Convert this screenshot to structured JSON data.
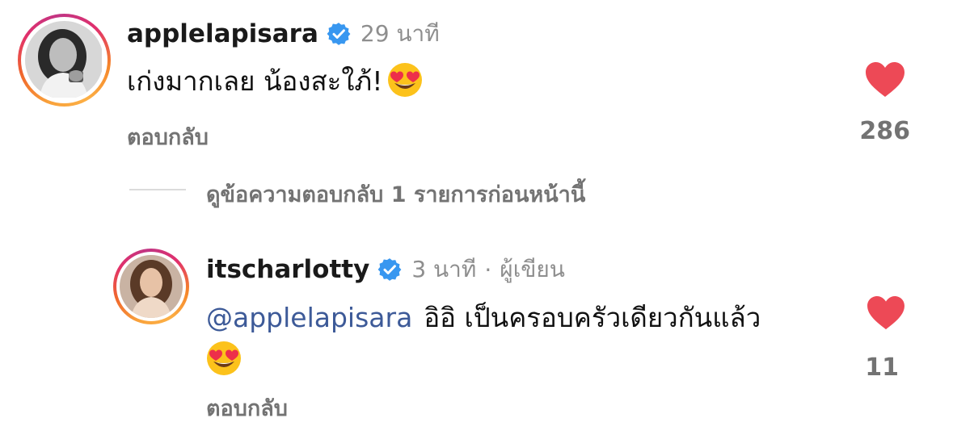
{
  "comments": [
    {
      "username": "applelapisara",
      "time": "29 นาที",
      "text": "เก่งมากเลย น้องสะใภ้!",
      "emoji": "smiling-face-with-heart-eyes",
      "reply_label": "ตอบกลับ",
      "likes": "286"
    },
    {
      "username": "itscharlotty",
      "time": "3 นาที",
      "separator": "·",
      "author_badge": "ผู้เขียน",
      "mention": "@applelapisara",
      "text": "อิอิ เป็นครอบครัวเดียวกันแล้ว",
      "emoji": "smiling-face-with-heart-eyes",
      "reply_label": "ตอบกลับ",
      "likes": "11"
    }
  ],
  "view_replies": {
    "label": "ดูข้อความตอบกลับ 1 รายการก่อนหน้านี้"
  },
  "colors": {
    "heart": "#ed4956",
    "verified": "#3897f0",
    "mention": "#3d5a98",
    "secondary_text": "#8e8e8e"
  }
}
